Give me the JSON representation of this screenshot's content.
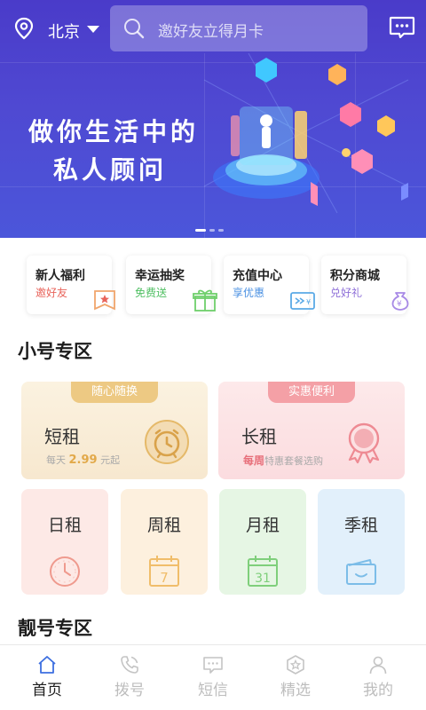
{
  "header": {
    "city": "北京",
    "search_placeholder": "邀好友立得月卡"
  },
  "banner": {
    "line1": "做你生活中的",
    "line2": "私人顾问",
    "page_count": 3,
    "active_page": 0
  },
  "quick_links": [
    {
      "title": "新人福利",
      "subtitle": "邀好友",
      "subtitle_color": "#e8635a",
      "icon": "bookmark-star-icon"
    },
    {
      "title": "幸运抽奖",
      "subtitle": "免费送",
      "subtitle_color": "#4fbf62",
      "icon": "gift-icon"
    },
    {
      "title": "充值中心",
      "subtitle": "享优惠",
      "subtitle_color": "#4a90e2",
      "icon": "card-icon"
    },
    {
      "title": "积分商城",
      "subtitle": "兑好礼",
      "subtitle_color": "#8e6fd8",
      "icon": "coin-bag-icon"
    }
  ],
  "section_small": {
    "title": "小号专区",
    "short_rent": {
      "tag": "随心随换",
      "title": "短租",
      "sub_prefix": "每天 ",
      "sub_value": "2.99",
      "sub_suffix": " 元起",
      "icon": "alarm-clock-icon"
    },
    "long_rent": {
      "tag": "实惠便利",
      "title": "长租",
      "sub_value": "每周",
      "sub_suffix": "特惠套餐选购",
      "icon": "medal-icon"
    },
    "plans": [
      {
        "title": "日租",
        "icon": "clock-icon"
      },
      {
        "title": "周租",
        "icon": "calendar-7-icon",
        "icon_text": "7"
      },
      {
        "title": "月租",
        "icon": "calendar-31-icon",
        "icon_text": "31"
      },
      {
        "title": "季租",
        "icon": "wallet-icon"
      }
    ]
  },
  "section_pretty": {
    "title": "靓号专区"
  },
  "tabbar": [
    {
      "label": "首页",
      "icon": "home-icon",
      "active": true
    },
    {
      "label": "拨号",
      "icon": "phone-icon",
      "active": false
    },
    {
      "label": "短信",
      "icon": "message-icon",
      "active": false
    },
    {
      "label": "精选",
      "icon": "hexagon-star-icon",
      "active": false
    },
    {
      "label": "我的",
      "icon": "user-icon",
      "active": false
    }
  ],
  "colors": {
    "banner": "#4f49d2",
    "active_tab": "#3d6fe0"
  }
}
